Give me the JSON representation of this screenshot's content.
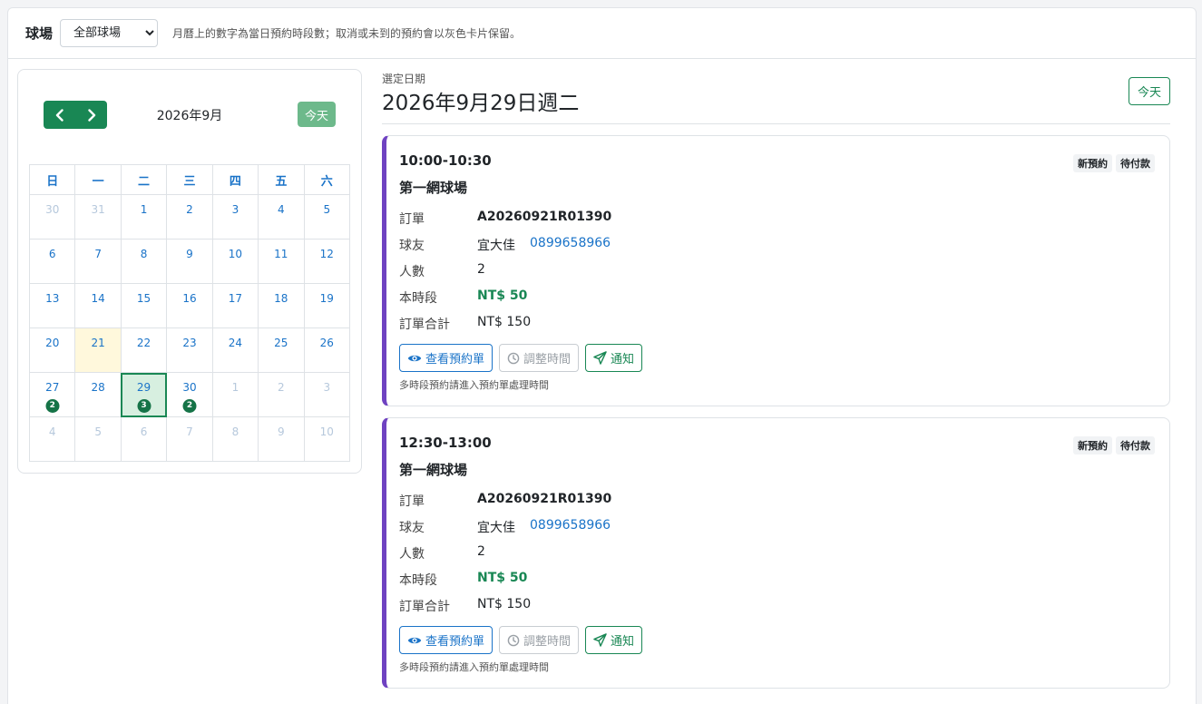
{
  "filter": {
    "label": "球場",
    "selected": "全部球場",
    "hint": "月曆上的數字為當日預約時段數；取消或未到的預約會以灰色卡片保留。"
  },
  "calendar": {
    "month_title": "2026年9月",
    "today_label": "今天",
    "weekdays": [
      "日",
      "一",
      "二",
      "三",
      "四",
      "五",
      "六"
    ],
    "weeks": [
      [
        {
          "d": "30",
          "m": true
        },
        {
          "d": "31",
          "m": true
        },
        {
          "d": "1"
        },
        {
          "d": "2"
        },
        {
          "d": "3"
        },
        {
          "d": "4"
        },
        {
          "d": "5"
        }
      ],
      [
        {
          "d": "6"
        },
        {
          "d": "7"
        },
        {
          "d": "8"
        },
        {
          "d": "9"
        },
        {
          "d": "10"
        },
        {
          "d": "11"
        },
        {
          "d": "12"
        }
      ],
      [
        {
          "d": "13"
        },
        {
          "d": "14"
        },
        {
          "d": "15"
        },
        {
          "d": "16"
        },
        {
          "d": "17"
        },
        {
          "d": "18"
        },
        {
          "d": "19"
        }
      ],
      [
        {
          "d": "20"
        },
        {
          "d": "21",
          "today": true
        },
        {
          "d": "22"
        },
        {
          "d": "23"
        },
        {
          "d": "24"
        },
        {
          "d": "25"
        },
        {
          "d": "26"
        }
      ],
      [
        {
          "d": "27",
          "count": "2"
        },
        {
          "d": "28"
        },
        {
          "d": "29",
          "count": "3",
          "selected": true
        },
        {
          "d": "30",
          "count": "2"
        },
        {
          "d": "1",
          "m": true
        },
        {
          "d": "2",
          "m": true
        },
        {
          "d": "3",
          "m": true
        }
      ],
      [
        {
          "d": "4",
          "m": true
        },
        {
          "d": "5",
          "m": true
        },
        {
          "d": "6",
          "m": true
        },
        {
          "d": "7",
          "m": true
        },
        {
          "d": "8",
          "m": true
        },
        {
          "d": "9",
          "m": true
        },
        {
          "d": "10",
          "m": true
        }
      ]
    ]
  },
  "detail": {
    "selected_label": "選定日期",
    "selected_date": "2026年9月29日週二",
    "today_button": "今天",
    "labels": {
      "order": "訂單",
      "player": "球友",
      "people": "人數",
      "slot_price": "本時段",
      "order_total": "訂單合計"
    },
    "actions": {
      "view": "查看預約單",
      "reschedule": "調整時間",
      "notify": "通知"
    },
    "note": "多時段預約請進入預約單處理時間",
    "bookings": [
      {
        "time": "10:00-10:30",
        "tags": [
          "新預約",
          "待付款"
        ],
        "court": "第一網球場",
        "order_id": "A20260921R01390",
        "player_name": "宜大佳",
        "phone": "0899658966",
        "people": "2",
        "slot_price": "NT$ 50",
        "order_total": "NT$ 150"
      },
      {
        "time": "12:30-13:00",
        "tags": [
          "新預約",
          "待付款"
        ],
        "court": "第一網球場",
        "order_id": "A20260921R01390",
        "player_name": "宜大佳",
        "phone": "0899658966",
        "people": "2",
        "slot_price": "NT$ 50",
        "order_total": "NT$ 150"
      }
    ]
  },
  "colors": {
    "primary": "#198754",
    "link": "#1a73c8",
    "card_accent": "#6f42c1",
    "today_bg": "#fff8dc",
    "selected_bg": "#d7efe0"
  }
}
